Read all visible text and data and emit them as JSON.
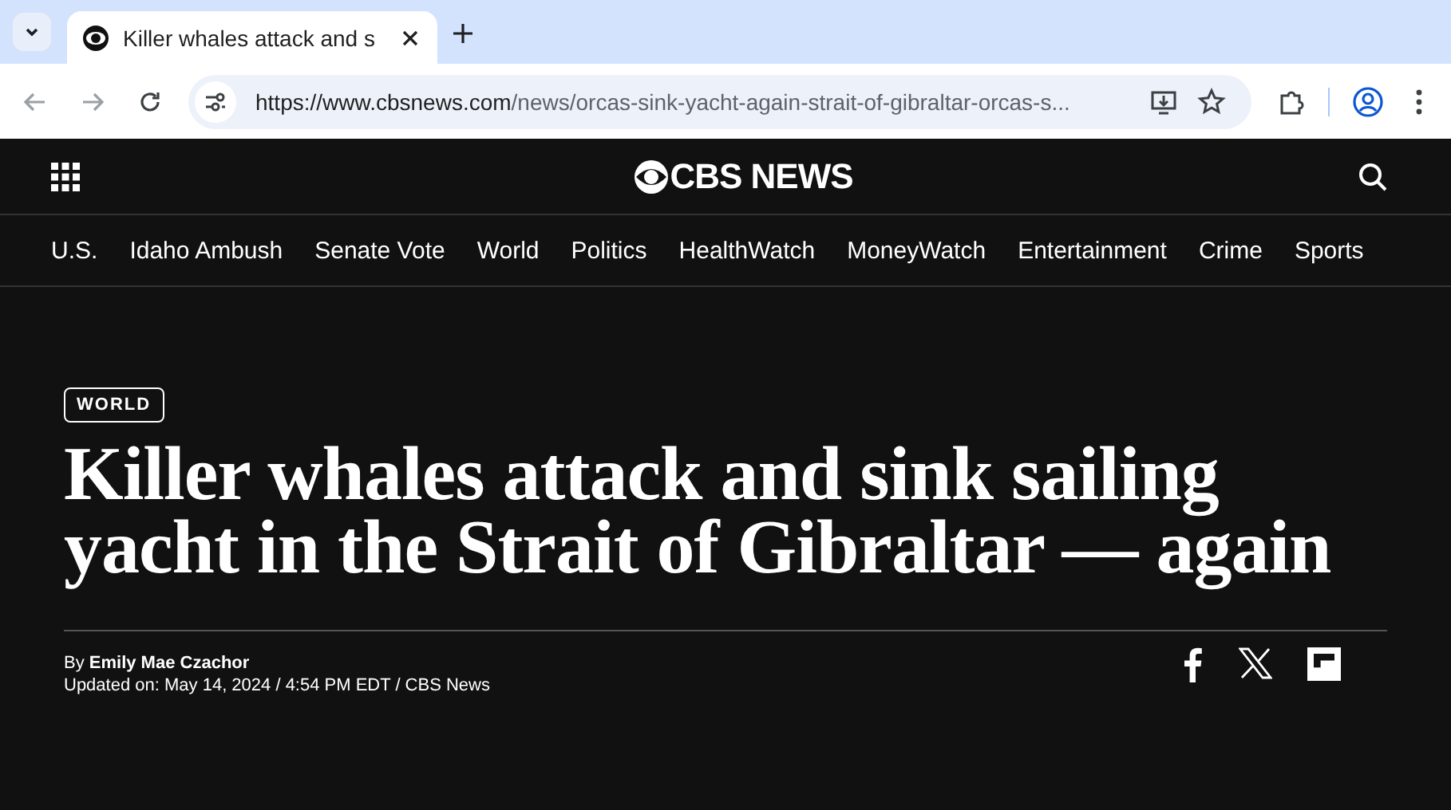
{
  "browser": {
    "tab": {
      "title": "Killer whales attack and s",
      "selected": true
    },
    "url": {
      "host": "https://www.cbsnews.com",
      "path": "/news/orcas-sink-yacht-again-strait-of-gibraltar-orcas-s..."
    }
  },
  "site": {
    "logo": "CBS NEWS",
    "nav": [
      "U.S.",
      "Idaho Ambush",
      "Senate Vote",
      "World",
      "Politics",
      "HealthWatch",
      "MoneyWatch",
      "Entertainment",
      "Crime",
      "Sports"
    ]
  },
  "article": {
    "category": "WORLD",
    "headline": "Killer whales attack and sink sailing yacht in the Strait of Gibraltar — again",
    "byline_prefix": "By",
    "author": "Emily Mae Czachor",
    "updated": "Updated on: May 14, 2024 / 4:54 PM EDT / CBS News"
  }
}
